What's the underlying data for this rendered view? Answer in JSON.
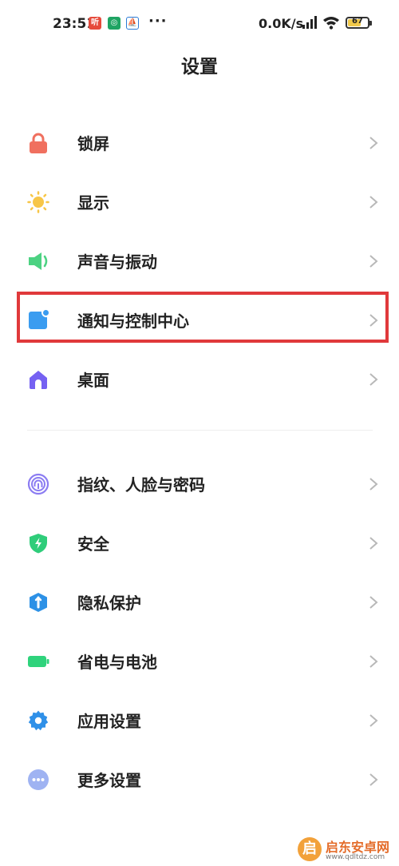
{
  "status_bar": {
    "time": "23:51",
    "app_badge_1": "听",
    "app_badge_2": "◎",
    "app_badge_3": "⛵",
    "more": "···",
    "net_speed": "0.0K/s",
    "battery_level": "67",
    "battery_fraction": 0.67
  },
  "header": {
    "title": "设置"
  },
  "groups": [
    {
      "items": [
        {
          "label": "锁屏",
          "icon": "lock-icon",
          "color": "#f0705f"
        },
        {
          "label": "显示",
          "icon": "sun-icon",
          "color": "#f7c647"
        },
        {
          "label": "声音与振动",
          "icon": "speaker-icon",
          "color": "#4cd282"
        },
        {
          "label": "通知与控制中心",
          "icon": "notification-icon",
          "color": "#3a9cf0"
        },
        {
          "label": "桌面",
          "icon": "home-icon",
          "color": "#7561f2"
        }
      ]
    },
    {
      "items": [
        {
          "label": "指纹、人脸与密码",
          "icon": "fingerprint-icon",
          "color": "#8b7cf2"
        },
        {
          "label": "安全",
          "icon": "shield-icon",
          "color": "#2fcd7a"
        },
        {
          "label": "隐私保护",
          "icon": "privacy-icon",
          "color": "#2d91e6"
        },
        {
          "label": "省电与电池",
          "icon": "battery-icon",
          "color": "#2fd37c"
        },
        {
          "label": "应用设置",
          "icon": "gear-icon",
          "color": "#2f90e8"
        },
        {
          "label": "更多设置",
          "icon": "more-dots-icon",
          "color": "#9fb3f2"
        }
      ]
    }
  ],
  "watermark": {
    "logo": "启",
    "title": "启东安卓网",
    "url": "www.qdltdz.com"
  },
  "colors": {
    "highlight": "#e0393b",
    "text": "#222222",
    "chevron": "#b8b8b8",
    "divider": "#eeeeee"
  }
}
